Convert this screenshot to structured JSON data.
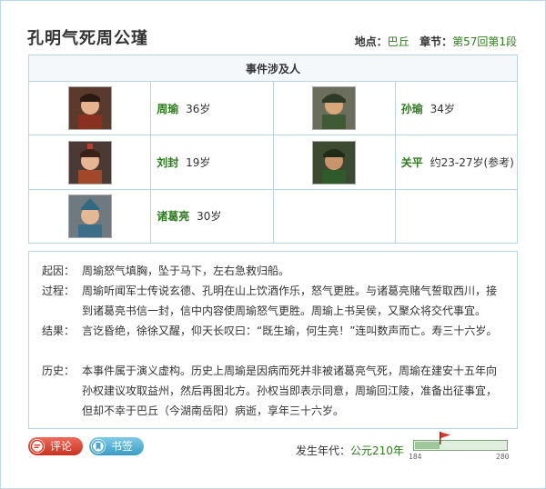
{
  "page": {
    "title": "孔明气死周公瑾",
    "location_key": "地点：",
    "location_value": "巴丘",
    "chapter_key": "章节：",
    "chapter_value": "第57回第1段"
  },
  "people_table": {
    "header": "事件涉及人",
    "people": [
      {
        "name": "周瑜",
        "age": "36岁",
        "avatar": "zhou-yu-portrait-icon"
      },
      {
        "name": "孙瑜",
        "age": "34岁",
        "avatar": "sun-yu-portrait-icon"
      },
      {
        "name": "刘封",
        "age": "19岁",
        "avatar": "liu-feng-portrait-icon"
      },
      {
        "name": "关平",
        "age": "约23-27岁(参考)",
        "avatar": "guan-ping-portrait-icon"
      },
      {
        "name": "诸葛亮",
        "age": "30岁",
        "avatar": "zhuge-liang-portrait-icon"
      }
    ]
  },
  "events": {
    "cause_label": "起因：",
    "cause_text": "周瑜怒气填胸，坠于马下，左右急救归船。",
    "process_label": "过程：",
    "process_text": "周瑜听闻军士传说玄德、孔明在山上饮酒作乐，怒气更胜。与诸葛亮赌气誓取西川，接到诸葛亮书信一封，信中内容使周瑜怒气更胜。周瑜上书吴侯，又聚众将交代事宜。",
    "result_label": "结果：",
    "result_text": "言讫昏绝，徐徐又醒，仰天长叹曰：“既生瑜，何生亮！”连叫数声而亡。寿三十六岁。",
    "history_label": "历史：",
    "history_text": "本事件属于演义虚构。历史上周瑜是因病而死并非被诸葛亮气死，周瑜在建安十五年向孙权建议攻取益州，然后再图北方。孙权当即表示同意，周瑜回江陵，准备出征事宜，但却不幸于巴丘（今湖南岳阳）病逝，享年三十六岁。"
  },
  "footer": {
    "comment_label": "评论",
    "bookmark_label": "书签",
    "year_key": "发生年代：",
    "year_value": "公元210年",
    "timeline_start": "184",
    "timeline_end": "280",
    "timeline_current": 210
  },
  "colors": {
    "accent_green": "#2e7d1e",
    "border_blue": "#b9d3e8",
    "comment_red": "#d9402b",
    "bookmark_blue": "#4aa8d0"
  }
}
